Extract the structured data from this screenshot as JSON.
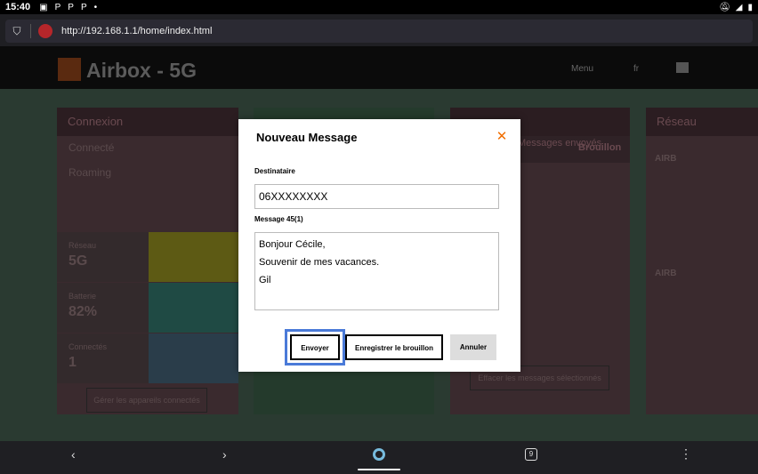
{
  "status_bar": {
    "time": "15:40",
    "icons": [
      "image-icon",
      "p-icon",
      "p-icon",
      "p-icon",
      "dot-icon"
    ]
  },
  "browser": {
    "url": "http://192.168.1.1/home/index.html"
  },
  "site": {
    "title": "Airbox - 5G",
    "menu_label": "Menu",
    "lang_label": "fr",
    "panels": {
      "connexion": {
        "title": "Connexion",
        "rows": [
          "Connecté",
          "Roaming"
        ],
        "tiles": [
          {
            "label": "Réseau",
            "value": "5G"
          },
          {
            "label": "Batterie",
            "value": "82%"
          },
          {
            "label": "Connectés",
            "value": "1"
          }
        ],
        "manage_button": "Gérer les appareils connectés"
      },
      "messages": {
        "tab_left": "Messages envoyés",
        "tab_right": "Brouillon",
        "delete_button": "Effacer les messages sélectionnés"
      },
      "reseau": {
        "title": "Réseau",
        "items": [
          "AIRB",
          "AIRB"
        ]
      }
    }
  },
  "modal": {
    "title": "Nouveau Message",
    "recipient_label": "Destinataire",
    "recipient_value": "06XXXXXXXX",
    "message_label": "Message 45(1)",
    "message_lines": [
      "Bonjour Cécile,",
      "Souvenir de mes vacances.",
      "Gil"
    ],
    "send_button": "Envoyer",
    "save_draft_button": "Enregistrer le brouillon",
    "cancel_button": "Annuler"
  },
  "nav_bar": {
    "tab_count": "9"
  },
  "colors": {
    "accent": "#f16e00",
    "focus_ring": "#4a7ad8"
  }
}
